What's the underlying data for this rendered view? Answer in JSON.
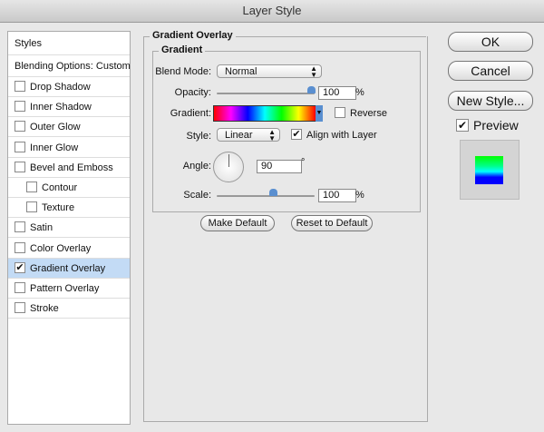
{
  "window": {
    "title": "Layer Style"
  },
  "sidebar": {
    "header": "Styles",
    "blending": "Blending Options: Custom",
    "items": [
      {
        "label": "Drop Shadow",
        "checked": false
      },
      {
        "label": "Inner Shadow",
        "checked": false
      },
      {
        "label": "Outer Glow",
        "checked": false
      },
      {
        "label": "Inner Glow",
        "checked": false
      },
      {
        "label": "Bevel and Emboss",
        "checked": false
      },
      {
        "label": "Contour",
        "checked": false,
        "indent": true
      },
      {
        "label": "Texture",
        "checked": false,
        "indent": true
      },
      {
        "label": "Satin",
        "checked": false
      },
      {
        "label": "Color Overlay",
        "checked": false
      },
      {
        "label": "Gradient Overlay",
        "checked": true,
        "selected": true
      },
      {
        "label": "Pattern Overlay",
        "checked": false
      },
      {
        "label": "Stroke",
        "checked": false
      }
    ]
  },
  "panel": {
    "title": "Gradient Overlay",
    "group": "Gradient",
    "blend_mode_label": "Blend Mode:",
    "blend_mode": "Normal",
    "opacity_label": "Opacity:",
    "opacity": "100",
    "opacity_unit": "%",
    "opacity_value": 100,
    "gradient_label": "Gradient:",
    "gradient_colors": [
      "#ff0000",
      "#ff00ff",
      "#0000ff",
      "#00ffff",
      "#00ff00",
      "#ffff00",
      "#ff0000"
    ],
    "reverse_label": "Reverse",
    "reverse": false,
    "style_label": "Style:",
    "style": "Linear",
    "align_label": "Align with Layer",
    "align": true,
    "angle_label": "Angle:",
    "angle": "90",
    "angle_unit": "°",
    "scale_label": "Scale:",
    "scale": "100",
    "scale_unit": "%",
    "make_default": "Make Default",
    "reset_default": "Reset to Default"
  },
  "buttons": {
    "ok": "OK",
    "cancel": "Cancel",
    "new_style": "New Style...",
    "preview": "Preview",
    "preview_checked": true
  }
}
